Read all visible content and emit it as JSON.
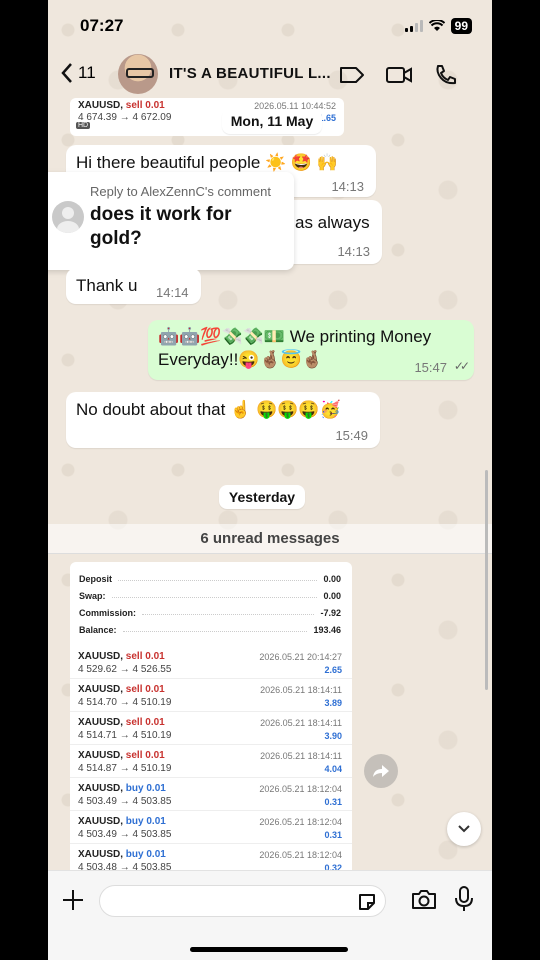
{
  "status": {
    "time": "07:27",
    "battery": "99"
  },
  "header": {
    "back_count": "11",
    "title": "IT'S A BEAUTIFUL L..."
  },
  "top_trade": {
    "symbol": "XAUUSD,",
    "side": "sell 0.01",
    "prices": "4 674.39 → 4 672.09",
    "date": "2026.05.11 10:44:52",
    "profit": "1.65",
    "hd": "HD"
  },
  "date_pill_1": "Mon, 11 May",
  "messages": [
    {
      "text": "Hi there beautiful people ☀️ 🤩 🙌",
      "time": "14:13"
    },
    {
      "text": "as always",
      "time": "14:13"
    },
    {
      "text": "Thank u",
      "time": "14:14"
    },
    {
      "line1": "🤖🤖💯💸💸💵 We printing Money",
      "line2": "Everyday!!😜🤞🏽😇🤞🏽",
      "time": "15:47",
      "status": "✓✓"
    },
    {
      "text": "No doubt about that ☝️ 🤑🤑🤑🥳",
      "time": "15:49"
    }
  ],
  "reply_card": {
    "header": "Reply to AlexZennC's comment",
    "text_line1": "does it work for",
    "text_line2": "gold?"
  },
  "date_pill_2": "Yesterday",
  "unread": "6 unread messages",
  "summary": [
    {
      "label": "Deposit",
      "value": "0.00"
    },
    {
      "label": "Swap:",
      "value": "0.00"
    },
    {
      "label": "Commission:",
      "value": "-7.92"
    },
    {
      "label": "Balance:",
      "value": "193.46"
    }
  ],
  "trades": [
    {
      "symbol": "XAUUSD,",
      "side": "sell 0.01",
      "type": "sell",
      "prices": "4 529.62 → 4 526.55",
      "date": "2026.05.21 20:14:27",
      "profit": "2.65"
    },
    {
      "symbol": "XAUUSD,",
      "side": "sell 0.01",
      "type": "sell",
      "prices": "4 514.70 → 4 510.19",
      "date": "2026.05.21 18:14:11",
      "profit": "3.89"
    },
    {
      "symbol": "XAUUSD,",
      "side": "sell 0.01",
      "type": "sell",
      "prices": "4 514.71 → 4 510.19",
      "date": "2026.05.21 18:14:11",
      "profit": "3.90"
    },
    {
      "symbol": "XAUUSD,",
      "side": "sell 0.01",
      "type": "sell",
      "prices": "4 514.87 → 4 510.19",
      "date": "2026.05.21 18:14:11",
      "profit": "4.04"
    },
    {
      "symbol": "XAUUSD,",
      "side": "buy 0.01",
      "type": "buy",
      "prices": "4 503.49 → 4 503.85",
      "date": "2026.05.21 18:12:04",
      "profit": "0.31"
    },
    {
      "symbol": "XAUUSD,",
      "side": "buy 0.01",
      "type": "buy",
      "prices": "4 503.49 → 4 503.85",
      "date": "2026.05.21 18:12:04",
      "profit": "0.31"
    },
    {
      "symbol": "XAUUSD,",
      "side": "buy 0.01",
      "type": "buy",
      "prices": "4 503.48 → 4 503.85",
      "date": "2026.05.21 18:12:04",
      "profit": "0.32"
    }
  ],
  "colors": {
    "outgoing_bubble": "#d9fdd3",
    "sell": "#c8322f",
    "buy": "#2e6fd3",
    "wallpaper": "#efe7dd"
  },
  "icons": [
    "back-chevron-icon",
    "video-call-icon",
    "voice-call-icon",
    "label-icon",
    "plus-icon",
    "sticker-icon",
    "camera-icon",
    "microphone-icon",
    "forward-icon",
    "scroll-down-icon"
  ]
}
